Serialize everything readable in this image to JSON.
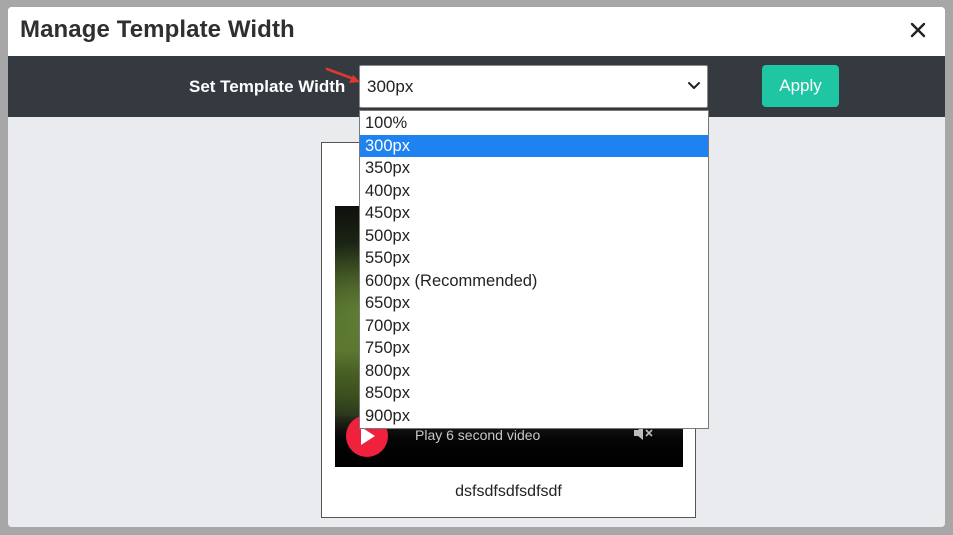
{
  "modal": {
    "title": "Manage Template Width",
    "close_icon": "close-icon"
  },
  "toolbar": {
    "label": "Set Template Width",
    "select_value": "300px",
    "apply_label": "Apply",
    "colors": {
      "bar": "#343a40",
      "apply": "#1ec6a3",
      "arrow": "#e0382f"
    }
  },
  "dropdown": {
    "options": [
      "100%",
      "300px",
      "350px",
      "400px",
      "450px",
      "500px",
      "550px",
      "600px (Recommended)",
      "650px",
      "700px",
      "750px",
      "800px",
      "850px",
      "900px"
    ],
    "selected_index": 1,
    "highlight_color": "#1e82f0"
  },
  "preview": {
    "video_caption": "Play 6 second video",
    "card_text": "dsfsdfsdfsdfsdf",
    "play_color": "#f0213d"
  }
}
